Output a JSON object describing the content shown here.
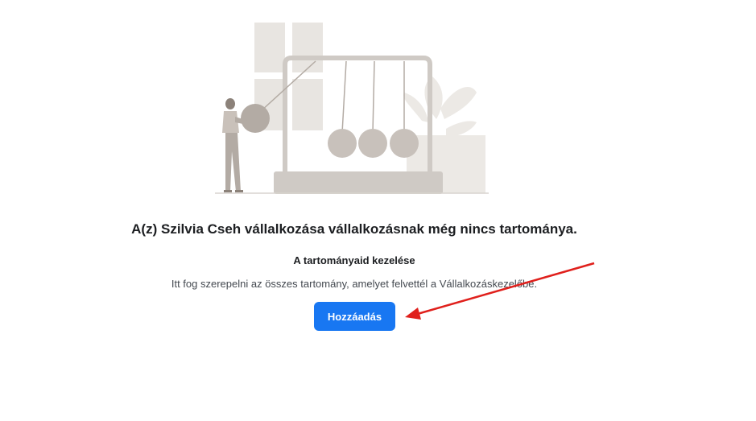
{
  "empty_state": {
    "title": "A(z) Szilvia Cseh vállalkozása vállalkozásnak még nincs tartománya.",
    "section_heading": "A tartományaid kezelése",
    "description": "Itt fog szerepelni az összes tartomány, amelyet felvettél a Vállalkozáskezelőbe.",
    "add_button_label": "Hozzáadás",
    "illustration_icon": "newtons-cradle-illustration"
  },
  "annotation": {
    "arrow_color": "#e0201c",
    "arrow_icon": "red-arrow-pointer"
  },
  "colors": {
    "accent": "#1877f2",
    "text_primary": "#1c1e21",
    "text_secondary": "#444950",
    "illustration_dark": "#b3aba4",
    "illustration_light": "#e6e3df"
  }
}
